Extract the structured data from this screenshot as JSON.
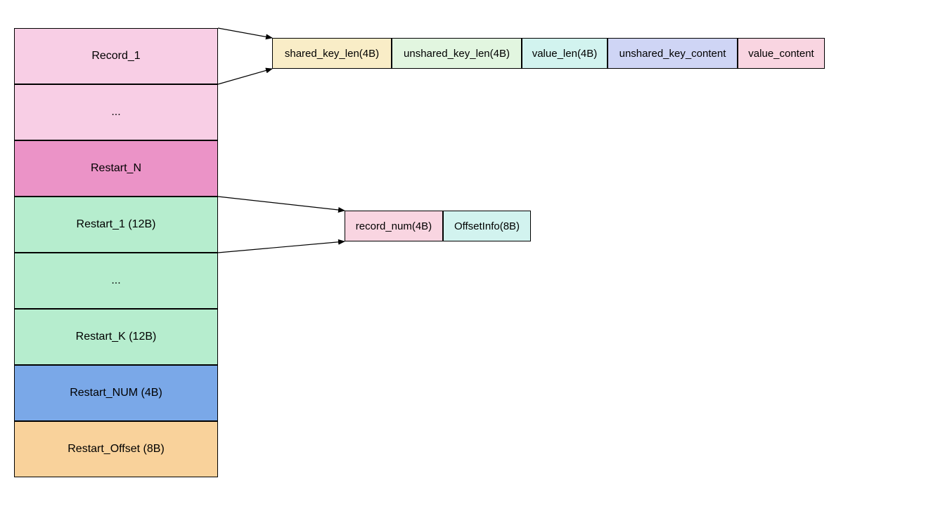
{
  "colors": {
    "pink": "#f8cee5",
    "pink_dark": "#eb93c7",
    "green_light": "#b6edce",
    "blue": "#7aa8e8",
    "peach": "#f9d29b",
    "cream": "#f9edc7",
    "mint": "#e2f6e0",
    "cyan": "#d2f3ef",
    "lavender": "#cfd5f5",
    "rose": "#f9d5e1"
  },
  "mainStack": [
    {
      "id": "record-1",
      "label": "Record_1",
      "colorKey": "pink"
    },
    {
      "id": "record-ellipsis",
      "label": "...",
      "colorKey": "pink"
    },
    {
      "id": "restart-n",
      "label": "Restart_N",
      "colorKey": "pink_dark"
    },
    {
      "id": "restart-1",
      "label": "Restart_1 (12B)",
      "colorKey": "green_light"
    },
    {
      "id": "restart-ellipsis",
      "label": "...",
      "colorKey": "green_light"
    },
    {
      "id": "restart-k",
      "label": "Restart_K (12B)",
      "colorKey": "green_light"
    },
    {
      "id": "restart-num",
      "label": "Restart_NUM (4B)",
      "colorKey": "blue"
    },
    {
      "id": "restart-offset",
      "label": "Restart_Offset (8B)",
      "colorKey": "peach"
    }
  ],
  "recordDetail": [
    {
      "id": "shared-key-len",
      "label": "shared_key_len(4B)",
      "colorKey": "cream"
    },
    {
      "id": "unshared-key-len",
      "label": "unshared_key_len(4B)",
      "colorKey": "mint"
    },
    {
      "id": "value-len",
      "label": "value_len(4B)",
      "colorKey": "cyan"
    },
    {
      "id": "unshared-key-content",
      "label": "unshared_key_content",
      "colorKey": "lavender"
    },
    {
      "id": "value-content",
      "label": "value_content",
      "colorKey": "rose"
    }
  ],
  "restartDetail": [
    {
      "id": "record-num",
      "label": "record_num(4B)",
      "colorKey": "rose"
    },
    {
      "id": "offset-info",
      "label": "OffsetInfo(8B)",
      "colorKey": "cyan"
    }
  ]
}
